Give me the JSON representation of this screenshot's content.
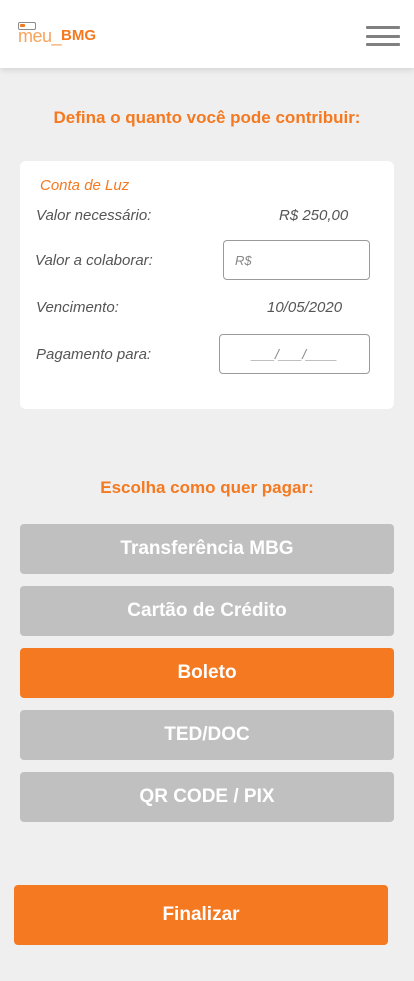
{
  "header": {
    "logo_part_a": "meu_",
    "logo_part_b": "BMG",
    "menu_icon": "hamburger-menu-icon"
  },
  "contribution": {
    "title": "Defina o quanto você pode contribuir:",
    "bill_name": "Conta de Luz",
    "required_label": "Valor necessário:",
    "required_value": "R$ 250,00",
    "collab_label": "Valor a colaborar:",
    "collab_placeholder": "R$",
    "due_label": "Vencimento:",
    "due_value": "10/05/2020",
    "payment_date_label": "Pagamento para:",
    "payment_date_placeholder": "___/___/____"
  },
  "payment": {
    "title": "Escolha como quer pagar:",
    "options": [
      {
        "label": "Transferência MBG",
        "selected": false
      },
      {
        "label": "Cartão de Crédito",
        "selected": false
      },
      {
        "label": "Boleto",
        "selected": true
      },
      {
        "label": "TED/DOC",
        "selected": false
      },
      {
        "label": "QR CODE / PIX",
        "selected": false
      }
    ]
  },
  "finish_label": "Finalizar",
  "colors": {
    "accent": "#f47920",
    "inactive": "#c0c0c0",
    "background": "#efefef"
  }
}
